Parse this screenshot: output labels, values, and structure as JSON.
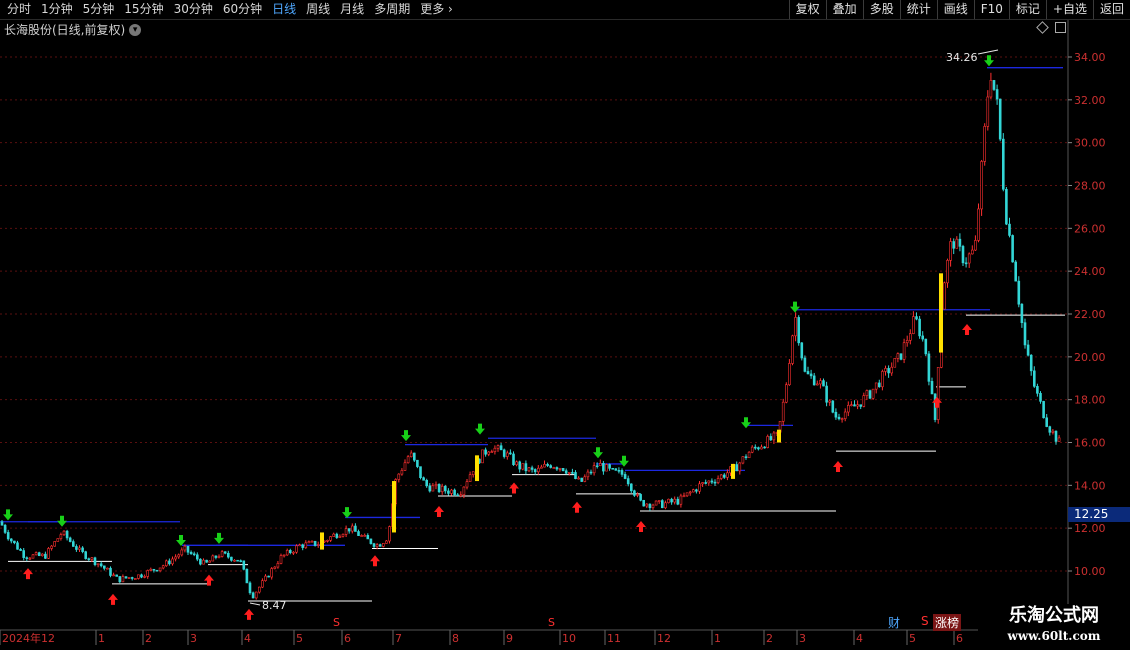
{
  "toolbar": {
    "periods": [
      "分时",
      "1分钟",
      "5分钟",
      "15分钟",
      "30分钟",
      "60分钟",
      "日线",
      "周线",
      "月线",
      "多周期",
      "更多"
    ],
    "active": "日线",
    "buttons": [
      "复权",
      "叠加",
      "多股",
      "统计",
      "画线",
      "F10",
      "标记",
      "+自选",
      "返回"
    ]
  },
  "stock": {
    "title": "长海股份(日线,前复权)"
  },
  "icons": [
    "dropdown-icon",
    "diamond-icon",
    "square-icon",
    "chevron-right-icon"
  ],
  "colors": {
    "up": "#ff3030",
    "down": "#33d6d6",
    "grid": "#5a0f0f",
    "blue_line": "#1c28e0",
    "white_line": "#ffffff",
    "buy": "#ff1e1e",
    "sell": "#18d018",
    "highlight": "#ffe000",
    "price_box": "#0b2a7a"
  },
  "chart_data": {
    "type": "candlestick",
    "y_ticks": [
      "10.00",
      "12.00",
      "14.00",
      "16.00",
      "18.00",
      "20.00",
      "22.00",
      "24.00",
      "26.00",
      "28.00",
      "30.00",
      "32.00",
      "34.00"
    ],
    "ylim": [
      9.5,
      34.7
    ],
    "x_labels": [
      "2024年12",
      "1",
      "2",
      "3",
      "4",
      "5",
      "6",
      "7",
      "8",
      "9",
      "10",
      "11",
      "12",
      "1",
      "2",
      "3",
      "4",
      "5",
      "6"
    ],
    "max_label": "34.26",
    "min_label": "8.47",
    "current_price": "12.25",
    "close_path": [
      [
        0,
        12.3
      ],
      [
        10,
        11.5
      ],
      [
        25,
        10.7
      ],
      [
        45,
        10.7
      ],
      [
        62,
        11.8
      ],
      [
        80,
        10.9
      ],
      [
        100,
        10.3
      ],
      [
        118,
        9.6
      ],
      [
        140,
        9.8
      ],
      [
        165,
        10.3
      ],
      [
        185,
        11.0
      ],
      [
        205,
        10.3
      ],
      [
        220,
        10.8
      ],
      [
        240,
        10.5
      ],
      [
        252,
        8.8
      ],
      [
        265,
        9.6
      ],
      [
        280,
        10.6
      ],
      [
        300,
        11.2
      ],
      [
        320,
        11.3
      ],
      [
        335,
        11.7
      ],
      [
        350,
        12.0
      ],
      [
        365,
        11.5
      ],
      [
        378,
        11.2
      ],
      [
        388,
        11.6
      ],
      [
        396,
        14.3
      ],
      [
        410,
        15.5
      ],
      [
        425,
        14.0
      ],
      [
        440,
        13.8
      ],
      [
        460,
        13.7
      ],
      [
        478,
        15.2
      ],
      [
        490,
        15.8
      ],
      [
        505,
        15.5
      ],
      [
        518,
        14.9
      ],
      [
        535,
        14.6
      ],
      [
        550,
        15.0
      ],
      [
        565,
        14.8
      ],
      [
        580,
        14.1
      ],
      [
        598,
        15.0
      ],
      [
        612,
        14.6
      ],
      [
        625,
        14.5
      ],
      [
        640,
        13.2
      ],
      [
        660,
        13.1
      ],
      [
        680,
        13.3
      ],
      [
        700,
        14.0
      ],
      [
        720,
        14.4
      ],
      [
        735,
        14.8
      ],
      [
        750,
        15.6
      ],
      [
        765,
        16.0
      ],
      [
        778,
        16.3
      ],
      [
        785,
        18.3
      ],
      [
        795,
        22.0
      ],
      [
        805,
        19.2
      ],
      [
        820,
        18.8
      ],
      [
        835,
        17.2
      ],
      [
        848,
        17.5
      ],
      [
        858,
        17.8
      ],
      [
        870,
        18.3
      ],
      [
        885,
        19.2
      ],
      [
        900,
        20.0
      ],
      [
        915,
        21.8
      ],
      [
        925,
        20.5
      ],
      [
        935,
        17.0
      ],
      [
        942,
        23.0
      ],
      [
        952,
        25.5
      ],
      [
        965,
        24.5
      ],
      [
        975,
        25.0
      ],
      [
        982,
        29.0
      ],
      [
        990,
        33.5
      ],
      [
        998,
        31.5
      ],
      [
        1005,
        27.0
      ],
      [
        1015,
        24.0
      ],
      [
        1025,
        20.5
      ],
      [
        1035,
        18.5
      ],
      [
        1048,
        16.8
      ],
      [
        1062,
        15.8
      ]
    ],
    "blue_levels": [
      [
        0,
        57,
        12.3
      ],
      [
        28,
        180,
        12.3
      ],
      [
        182,
        248,
        11.2
      ],
      [
        216,
        345,
        11.2
      ],
      [
        345,
        420,
        12.5
      ],
      [
        405,
        488,
        15.9
      ],
      [
        488,
        596,
        16.2
      ],
      [
        596,
        625,
        15.0
      ],
      [
        625,
        745,
        14.7
      ],
      [
        745,
        793,
        16.8
      ],
      [
        793,
        990,
        22.2
      ],
      [
        987,
        1063,
        33.5
      ]
    ],
    "white_levels": [
      [
        8,
        112,
        10.45
      ],
      [
        112,
        208,
        9.4
      ],
      [
        208,
        248,
        10.3
      ],
      [
        248,
        372,
        8.6
      ],
      [
        372,
        438,
        11.05
      ],
      [
        438,
        512,
        13.5
      ],
      [
        512,
        576,
        14.5
      ],
      [
        576,
        640,
        13.6
      ],
      [
        640,
        836,
        12.8
      ],
      [
        836,
        936,
        15.6
      ],
      [
        936,
        966,
        18.6
      ],
      [
        966,
        1065,
        21.95
      ]
    ],
    "buy_arrows": [
      [
        28,
        9.9
      ],
      [
        113,
        8.7
      ],
      [
        209,
        9.6
      ],
      [
        249,
        8.0
      ],
      [
        375,
        10.5
      ],
      [
        439,
        12.8
      ],
      [
        514,
        13.9
      ],
      [
        577,
        13.0
      ],
      [
        641,
        12.1
      ],
      [
        838,
        14.9
      ],
      [
        937,
        17.9
      ],
      [
        967,
        21.3
      ]
    ],
    "sell_arrows": [
      [
        8,
        12.6
      ],
      [
        62,
        12.3
      ],
      [
        181,
        11.4
      ],
      [
        219,
        11.5
      ],
      [
        347,
        12.7
      ],
      [
        406,
        16.3
      ],
      [
        480,
        16.6
      ],
      [
        598,
        15.5
      ],
      [
        624,
        15.1
      ],
      [
        746,
        16.9
      ],
      [
        795,
        22.3
      ],
      [
        989,
        33.8
      ]
    ],
    "yellow_bars": [
      [
        322,
        11.0,
        11.8
      ],
      [
        394,
        11.8,
        14.2
      ],
      [
        477,
        14.2,
        15.4
      ],
      [
        733,
        14.3,
        15.0
      ],
      [
        779,
        16.0,
        16.6
      ],
      [
        941,
        20.2,
        23.9
      ]
    ],
    "s_markers": [
      336,
      551
    ]
  },
  "status": {
    "cai": "财",
    "s": "S",
    "zhangbang": "涨榜"
  },
  "watermark": {
    "line1": "乐淘公式网",
    "line2": "www.60lt.com"
  }
}
